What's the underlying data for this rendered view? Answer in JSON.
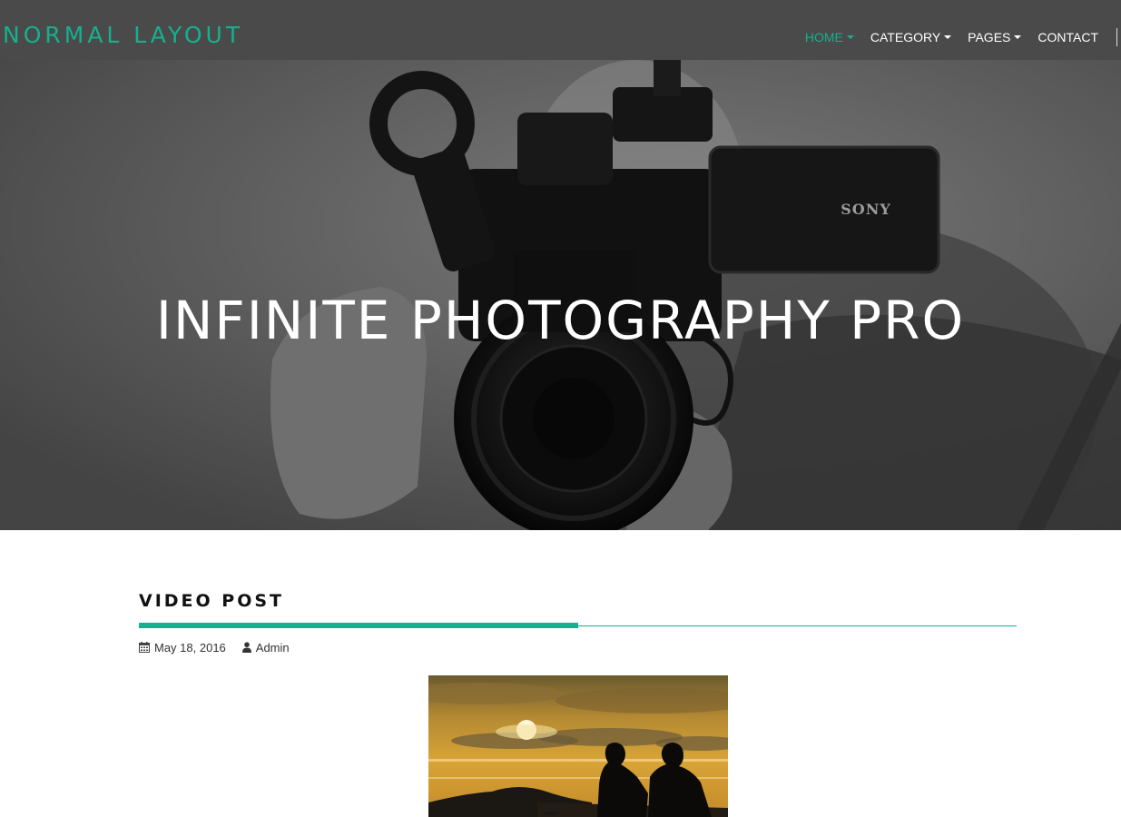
{
  "header": {
    "brand": "NORMAL LAYOUT",
    "nav": [
      {
        "label": "HOME",
        "active": true,
        "dropdown": true
      },
      {
        "label": "CATEGORY",
        "active": false,
        "dropdown": true
      },
      {
        "label": "PAGES",
        "active": false,
        "dropdown": true
      },
      {
        "label": "CONTACT",
        "active": false,
        "dropdown": false
      }
    ]
  },
  "hero": {
    "title": "INFINITE PHOTOGRAPHY PRO",
    "camera_brand": "SONY"
  },
  "post": {
    "title": "VIDEO POST",
    "date": "May 18, 2016",
    "author": "Admin",
    "date_icon": "calendar-icon",
    "author_icon": "user-icon"
  },
  "colors": {
    "accent": "#15b08f",
    "header_bg": "#4a4a4a"
  }
}
